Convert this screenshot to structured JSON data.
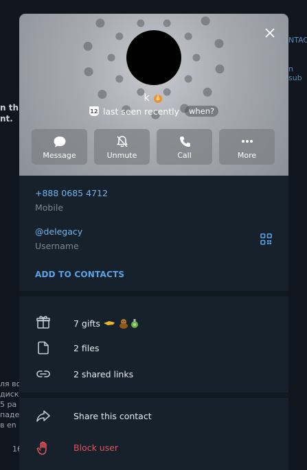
{
  "background": {
    "left_line1": "n this",
    "left_line2": "nt.",
    "right_line1": "NTACT",
    "right_line2": "n sub",
    "left_bottom": [
      "ля все",
      "диск",
      " 5 ра",
      "паде",
      " в en"
    ],
    "left_bottom_num": "16"
  },
  "profile": {
    "name": "k",
    "status": "last seen recently",
    "status_badge": "12",
    "when_label": "when?"
  },
  "actions": [
    {
      "label": "Message",
      "icon": "message-icon"
    },
    {
      "label": "Unmute",
      "icon": "bell-slash-icon"
    },
    {
      "label": "Call",
      "icon": "phone-icon"
    },
    {
      "label": "More",
      "icon": "more-dots-icon"
    }
  ],
  "info": {
    "phone": "+888 0685 4712",
    "phone_label": "Mobile",
    "username": "@delegacy",
    "username_label": "Username",
    "add_to_contacts": "ADD TO CONTACTS"
  },
  "media": [
    {
      "label": "7 gifts",
      "icon": "gift-icon"
    },
    {
      "label": "2 files",
      "icon": "file-icon"
    },
    {
      "label": "2 shared links",
      "icon": "link-icon"
    }
  ],
  "bottom_actions": [
    {
      "label": "Share this contact",
      "icon": "share-icon"
    },
    {
      "label": "Block user",
      "icon": "block-hand-icon",
      "color": "#e5535d"
    }
  ],
  "colors": {
    "accent": "#71b3f0",
    "danger": "#e5535d",
    "panel": "#17212b"
  }
}
